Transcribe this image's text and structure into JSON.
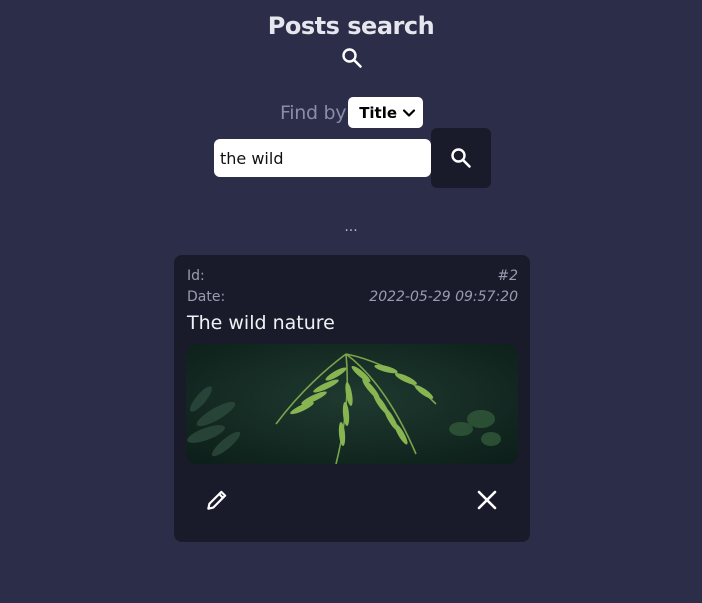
{
  "header": {
    "title": "Posts search",
    "icon": "search-icon"
  },
  "search": {
    "find_by_label": "Find by",
    "find_by_selected": "Title",
    "query_value": "the wild",
    "button_icon": "search-icon"
  },
  "status": {
    "loading_text": "..."
  },
  "posts": [
    {
      "id_label": "Id:",
      "id_value": "#2",
      "date_label": "Date:",
      "date_value": "2022-05-29 09:57:20",
      "title": "The wild nature",
      "image_icon": "fern-photo",
      "edit_icon": "pencil-icon",
      "delete_icon": "close-icon"
    }
  ],
  "colors": {
    "background": "#2c2d48",
    "card": "#1a1b2a",
    "muted_text": "#8b8ca8"
  }
}
